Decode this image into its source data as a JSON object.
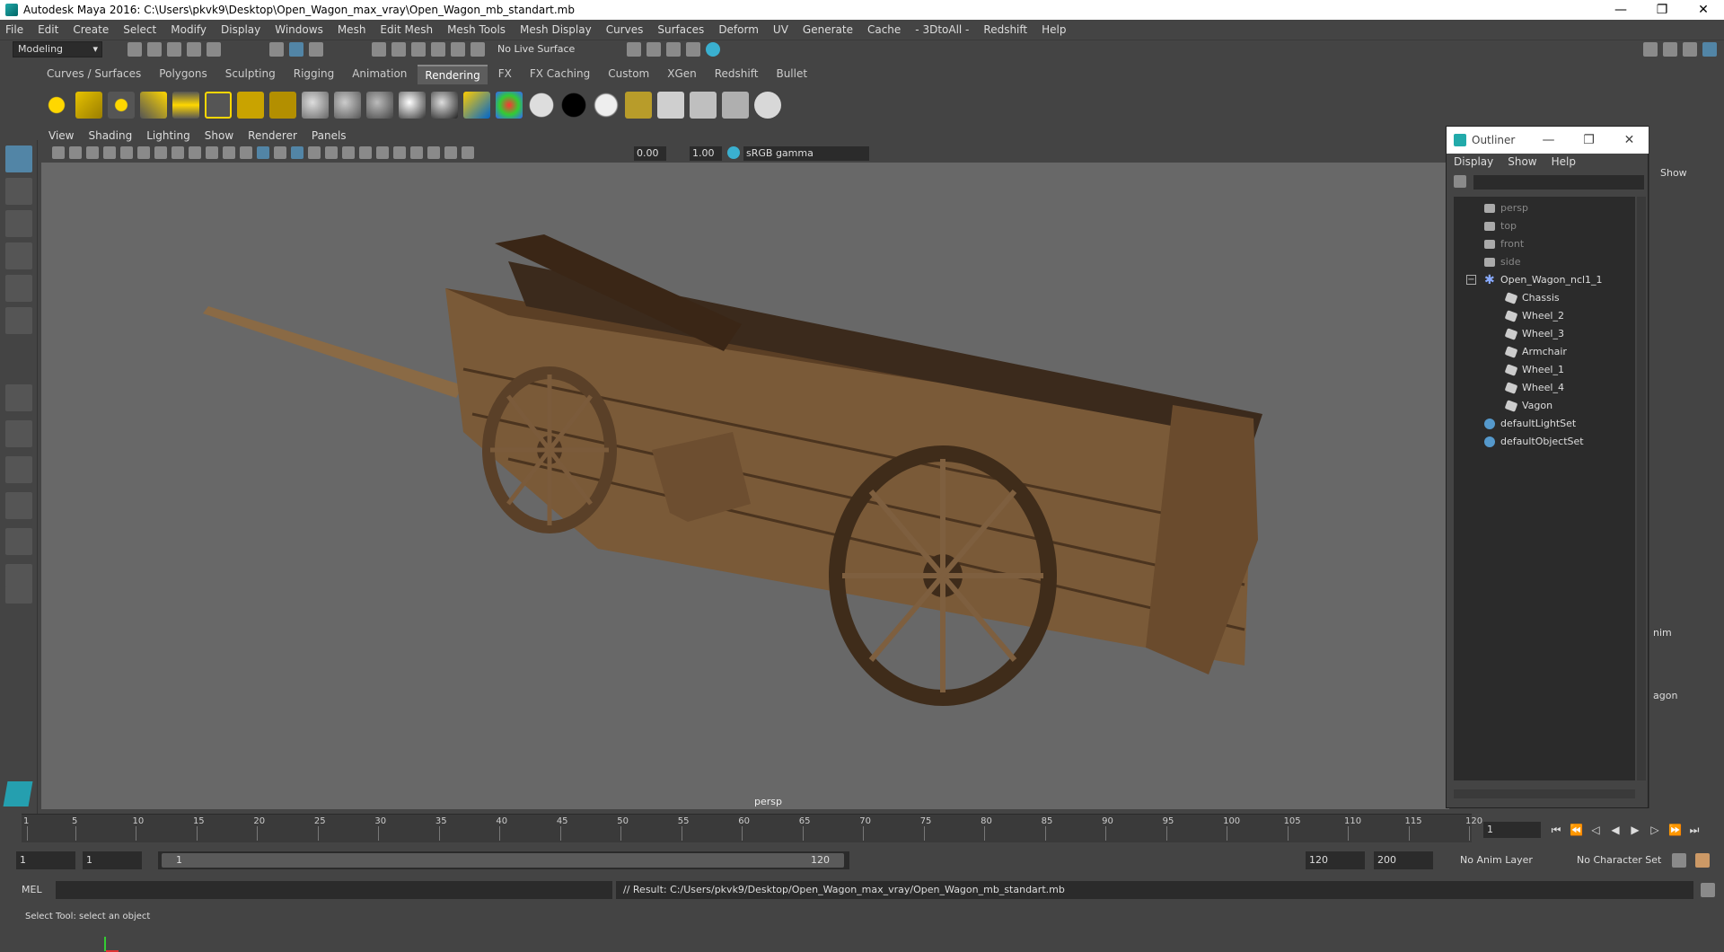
{
  "window": {
    "title": "Autodesk Maya 2016: C:\\Users\\pkvk9\\Desktop\\Open_Wagon_max_vray\\Open_Wagon_mb_standart.mb",
    "minimize": "—",
    "maximize": "❐",
    "close": "✕"
  },
  "menubar": [
    "File",
    "Edit",
    "Create",
    "Select",
    "Modify",
    "Display",
    "Windows",
    "Mesh",
    "Edit Mesh",
    "Mesh Tools",
    "Mesh Display",
    "Curves",
    "Surfaces",
    "Deform",
    "UV",
    "Generate",
    "Cache",
    "- 3DtoAll -",
    "Redshift",
    "Help"
  ],
  "toolbar": {
    "mode": "Modeling",
    "live_surface": "No Live Surface"
  },
  "shelf_tabs": [
    "Curves / Surfaces",
    "Polygons",
    "Sculpting",
    "Rigging",
    "Animation",
    "Rendering",
    "FX",
    "FX Caching",
    "Custom",
    "XGen",
    "Redshift",
    "Bullet"
  ],
  "shelf_active": "Rendering",
  "panel_menu": [
    "View",
    "Shading",
    "Lighting",
    "Show",
    "Renderer",
    "Panels"
  ],
  "panel_toolbar": {
    "exposure": "0.00",
    "gamma": "1.00",
    "color_space": "sRGB gamma"
  },
  "viewport": {
    "camera_label": "persp"
  },
  "outliner": {
    "title": "Outliner",
    "menu": [
      "Display",
      "Show",
      "Help"
    ],
    "items": [
      {
        "label": "persp",
        "kind": "camera",
        "dim": true
      },
      {
        "label": "top",
        "kind": "camera",
        "dim": true
      },
      {
        "label": "front",
        "kind": "camera",
        "dim": true
      },
      {
        "label": "side",
        "kind": "camera",
        "dim": true
      },
      {
        "label": "Open_Wagon_ncl1_1",
        "kind": "group",
        "dim": false
      },
      {
        "label": "Chassis",
        "kind": "mesh",
        "dim": false
      },
      {
        "label": "Wheel_2",
        "kind": "mesh",
        "dim": false
      },
      {
        "label": "Wheel_3",
        "kind": "mesh",
        "dim": false
      },
      {
        "label": "Armchair",
        "kind": "mesh",
        "dim": false
      },
      {
        "label": "Wheel_1",
        "kind": "mesh",
        "dim": false
      },
      {
        "label": "Wheel_4",
        "kind": "mesh",
        "dim": false
      },
      {
        "label": "Vagon",
        "kind": "mesh",
        "dim": false
      },
      {
        "label": "defaultLightSet",
        "kind": "set",
        "dim": false
      },
      {
        "label": "defaultObjectSet",
        "kind": "set",
        "dim": false
      }
    ]
  },
  "right_panel": {
    "show_label": "Show",
    "anim_tab": "nim",
    "obj_label": "agon"
  },
  "timeline": {
    "ticks": [
      "1",
      "5",
      "10",
      "15",
      "20",
      "25",
      "30",
      "35",
      "40",
      "45",
      "50",
      "55",
      "60",
      "65",
      "70",
      "75",
      "80",
      "85",
      "90",
      "95",
      "100",
      "105",
      "110",
      "115",
      "120"
    ],
    "current_frame": "1"
  },
  "range": {
    "start": "1",
    "anim_start": "1",
    "handle_start": "1",
    "handle_end": "120",
    "end": "120",
    "anim_end": "200",
    "anim_layer": "No Anim Layer",
    "character_set": "No Character Set"
  },
  "cmd": {
    "mel": "MEL",
    "result": "// Result: C:/Users/pkvk9/Desktop/Open_Wagon_max_vray/Open_Wagon_mb_standart.mb",
    "help": "Select Tool: select an object"
  }
}
